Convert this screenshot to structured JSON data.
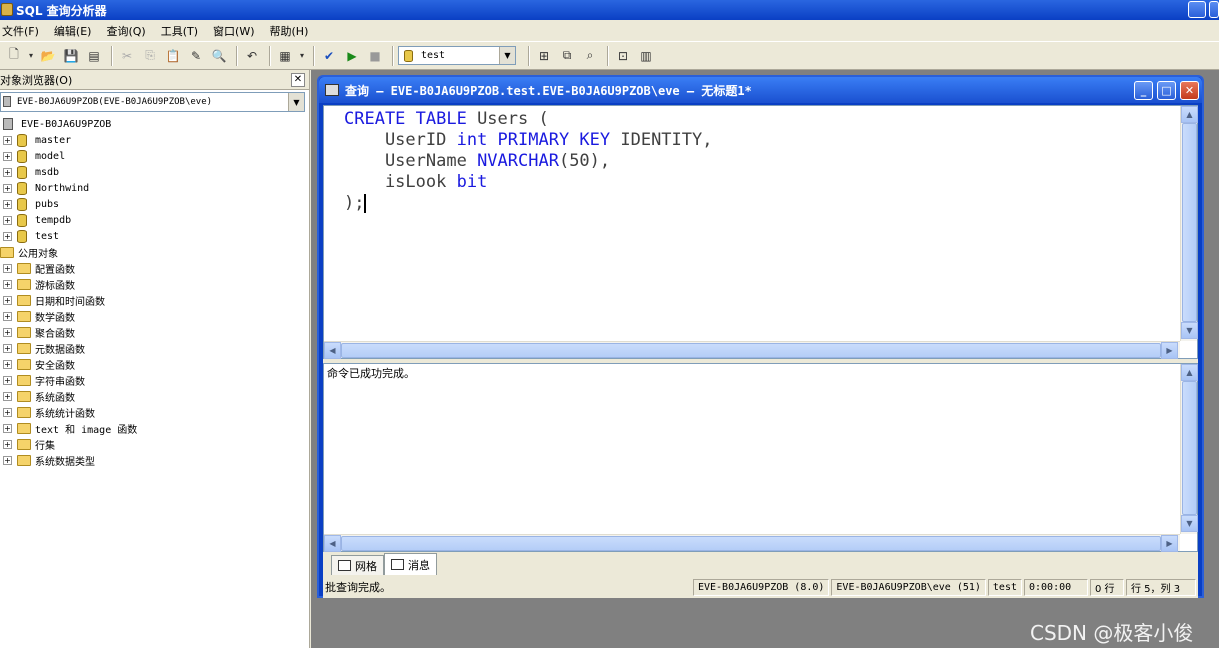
{
  "window": {
    "title": "SQL 查询分析器"
  },
  "menu": [
    "文件(F)",
    "编辑(E)",
    "查询(Q)",
    "工具(T)",
    "窗口(W)",
    "帮助(H)"
  ],
  "toolbar": {
    "database": "test"
  },
  "object_browser": {
    "title": "对象浏览器(O)",
    "server_select": "EVE-B0JA6U9PZOB(EVE-B0JA6U9PZOB\\eve)",
    "server": "EVE-B0JA6U9PZOB",
    "databases": [
      "master",
      "model",
      "msdb",
      "Northwind",
      "pubs",
      "tempdb",
      "test"
    ],
    "common_objects": "公用对象",
    "functions": [
      "配置函数",
      "游标函数",
      "日期和时间函数",
      "数学函数",
      "聚合函数",
      "元数据函数",
      "安全函数",
      "字符串函数",
      "系统函数",
      "系统统计函数",
      "text 和 image 函数",
      "行集",
      "系统数据类型"
    ]
  },
  "query_window": {
    "title": "查询 — EVE-B0JA6U9PZOB.test.EVE-B0JA6U9PZOB\\eve — 无标题1*",
    "code_lines": [
      [
        [
          "kw",
          "CREATE TABLE"
        ],
        [
          "tx",
          " Users ("
        ]
      ],
      [
        [
          "tx",
          "    UserID "
        ],
        [
          "kw",
          "int PRIMARY KEY"
        ],
        [
          "tx",
          " IDENTITY,"
        ]
      ],
      [
        [
          "tx",
          "    UserName "
        ],
        [
          "kw",
          "NVARCHAR"
        ],
        [
          "tx",
          "(50),"
        ]
      ],
      [
        [
          "tx",
          "    isLook "
        ],
        [
          "kw",
          "bit"
        ]
      ],
      [
        [
          "tx",
          ");"
        ]
      ]
    ],
    "result_message": "命令已成功完成。",
    "tabs": {
      "grid": "网格",
      "messages": "消息"
    }
  },
  "statusbar": {
    "message": "批查询完成。",
    "server": "EVE-B0JA6U9PZOB (8.0)",
    "user": "EVE-B0JA6U9PZOB\\eve (51)",
    "database": "test",
    "elapsed": "0:00:00",
    "rows": "0 行",
    "position": "行 5，列 3"
  },
  "watermark": "CSDN @极客小俊",
  "colors": {
    "keyword": "#1a1adf",
    "titlebar": "#0a3fc4"
  }
}
